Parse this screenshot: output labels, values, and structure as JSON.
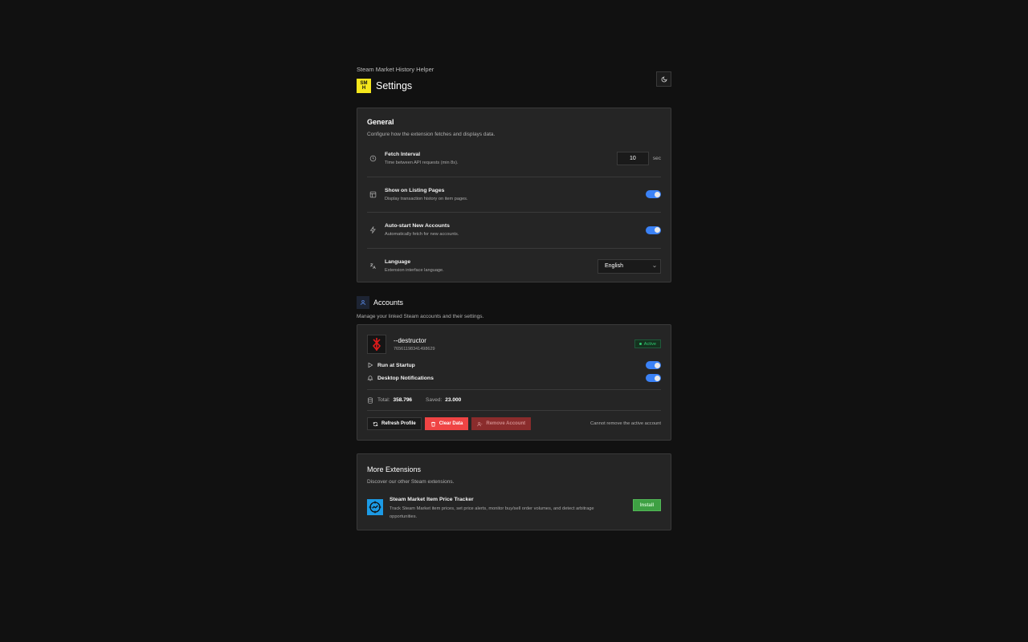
{
  "header": {
    "app_name": "Steam Market History Helper",
    "logo_text": "SMH",
    "title": "Settings",
    "theme_icon": "moon-icon"
  },
  "general": {
    "title": "General",
    "description": "Configure how the extension fetches and displays data.",
    "fetch_interval": {
      "label": "Fetch Interval",
      "description": "Time between API requests (min 8s).",
      "value": "10",
      "unit": "sec"
    },
    "show_listing": {
      "label": "Show on Listing Pages",
      "description": "Display transaction history on item pages.",
      "enabled": true
    },
    "auto_start": {
      "label": "Auto-start New Accounts",
      "description": "Automatically fetch for new accounts.",
      "enabled": true
    },
    "language": {
      "label": "Language",
      "description": "Extension interface language.",
      "value": "English"
    }
  },
  "accounts": {
    "title": "Accounts",
    "description": "Manage your linked Steam accounts and their settings.",
    "account": {
      "name": "--destructor",
      "steam_id": "76561198341498629",
      "status": "Active",
      "run_at_startup": {
        "label": "Run at Startup",
        "enabled": true
      },
      "notifications": {
        "label": "Desktop Notifications",
        "enabled": true
      },
      "total_label": "Total:",
      "total": "358.796",
      "saved_label": "Saved:",
      "saved": "23.000",
      "refresh_label": "Refresh Profile",
      "clear_label": "Clear Data",
      "remove_label": "Remove Account",
      "note": "Cannot remove the active account"
    }
  },
  "more": {
    "title": "More Extensions",
    "description": "Discover our other Steam extensions.",
    "extension": {
      "name": "Steam Market Item Price Tracker",
      "description": "Track Steam Market item prices, set price alerts, monitor buy/sell order volumes, and detect arbitrage opportunities.",
      "install_label": "Install"
    }
  },
  "colors": {
    "accent": "#3b82f6",
    "danger": "#ef4444",
    "success": "#3ea043",
    "active": "#2ecc71"
  }
}
